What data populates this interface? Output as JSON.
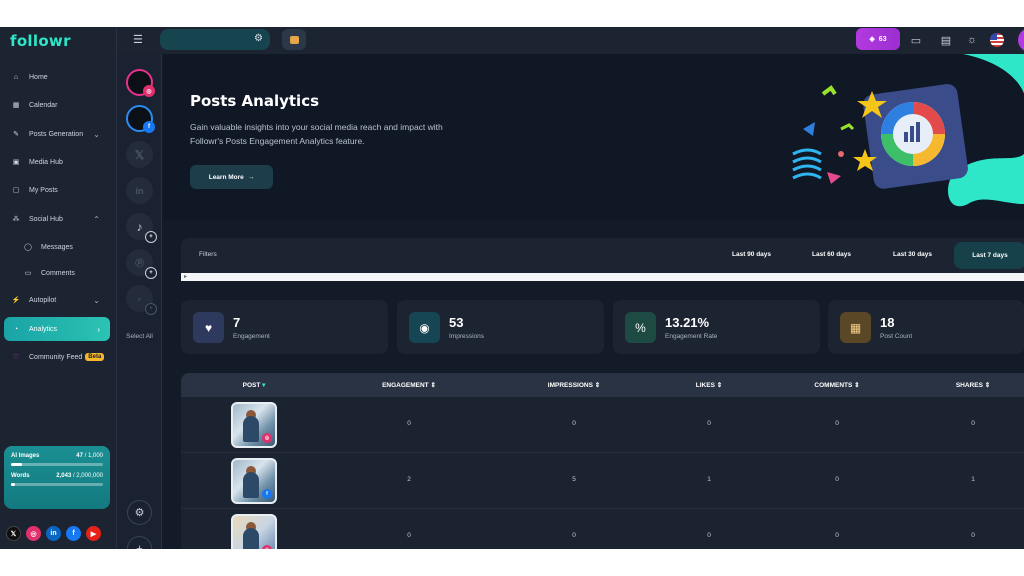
{
  "app": {
    "logo": "followr"
  },
  "sidebar": {
    "items": [
      {
        "label": "Home",
        "icon": "home-icon"
      },
      {
        "label": "Calendar",
        "icon": "calendar-icon"
      },
      {
        "label": "Posts Generation",
        "icon": "posts-generation-icon"
      },
      {
        "label": "Media Hub",
        "icon": "media-hub-icon"
      },
      {
        "label": "My Posts",
        "icon": "my-posts-icon"
      },
      {
        "label": "Social Hub",
        "icon": "social-hub-icon"
      },
      {
        "label": "Messages",
        "icon": "messages-icon"
      },
      {
        "label": "Comments",
        "icon": "comments-icon"
      },
      {
        "label": "Autopilot",
        "icon": "autopilot-icon"
      },
      {
        "label": "Analytics",
        "icon": "analytics-icon"
      },
      {
        "label": "Community Feed",
        "icon": "community-feed-icon",
        "badge": "Beta"
      }
    ],
    "usage": {
      "ai_images": {
        "label": "AI Images",
        "used": "47",
        "limit": "/ 1,000",
        "fraction": 0.047
      },
      "words": {
        "label": "Words",
        "used": "2,043",
        "limit": "/ 2,000,000",
        "fraction": 0.001
      }
    },
    "socials": [
      "x-icon",
      "instagram-icon",
      "linkedin-icon",
      "facebook-icon",
      "youtube-icon"
    ]
  },
  "accounts": {
    "select_all": "Select All"
  },
  "topbar": {
    "credits": "63"
  },
  "hero": {
    "title": "Posts Analytics",
    "description": "Gain valuable insights into your social media reach and impact with Followr's Posts Engagement Analytics feature.",
    "button": "Learn More",
    "button_arrow": "→"
  },
  "filters": {
    "label": "Filters",
    "ranges": [
      "Last 90 days",
      "Last 60 days",
      "Last 30 days",
      "Last 7 days"
    ],
    "active": "Last 7 days"
  },
  "stats": [
    {
      "value": "7",
      "label": "Engagement",
      "icon": "heart-icon",
      "color": "#2d3a5e"
    },
    {
      "value": "53",
      "label": "Impressions",
      "icon": "eye-icon",
      "color": "#164553"
    },
    {
      "value": "13.21%",
      "label": "Engagement Rate",
      "icon": "percent-icon",
      "color": "#1e4a44"
    },
    {
      "value": "18",
      "label": "Post Count",
      "icon": "calendar-icon",
      "color": "#5a4726"
    }
  ],
  "table": {
    "headers": [
      "POST",
      "ENGAGEMENT",
      "IMPRESSIONS",
      "LIKES",
      "COMMENTS",
      "SHARES"
    ],
    "rows": [
      {
        "network": "instagram",
        "engagement": "0",
        "impressions": "0",
        "likes": "0",
        "comments": "0",
        "shares": "0"
      },
      {
        "network": "facebook",
        "engagement": "2",
        "impressions": "5",
        "likes": "1",
        "comments": "0",
        "shares": "1"
      },
      {
        "network": "instagram",
        "engagement": "0",
        "impressions": "0",
        "likes": "0",
        "comments": "0",
        "shares": "0"
      }
    ]
  },
  "colors": {
    "accent": "#2bc3b3",
    "brand_teal": "#2ee6c8",
    "credits_purple": "#b33adf"
  }
}
